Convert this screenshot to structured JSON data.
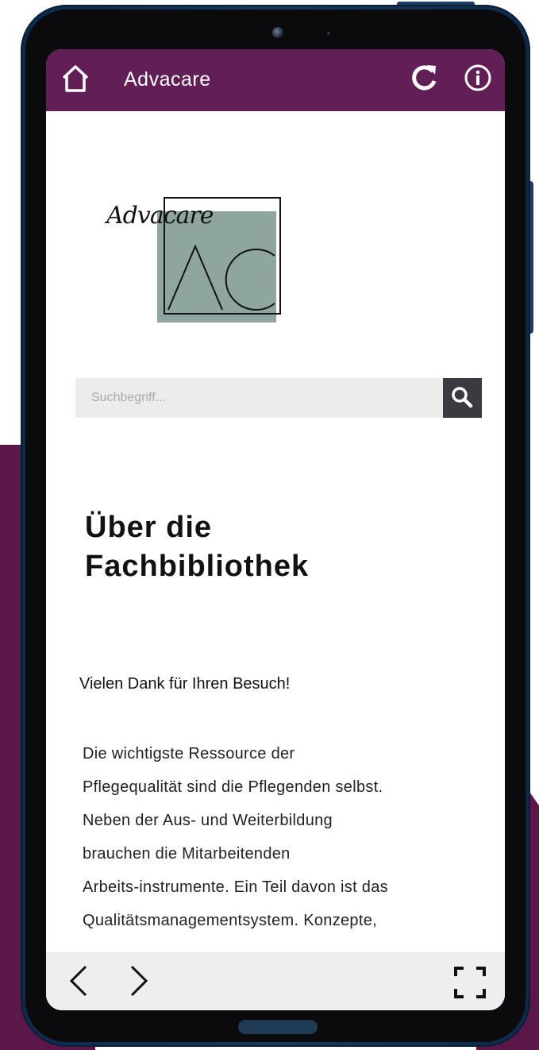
{
  "app": {
    "title": "Advacare"
  },
  "logo": {
    "script_text": "Advacare",
    "monogram": "AC"
  },
  "search": {
    "placeholder": "Suchbegriff..."
  },
  "content": {
    "heading_line1": "Über die",
    "heading_line2": "Fachbibliothek",
    "thanks": "Vielen Dank für Ihren Besuch!",
    "body_lines": [
      "Die wichtigste Ressource der",
      "Pflegequalität sind die Pflegenden selbst.",
      "Neben der Aus- und Weiterbildung",
      "brauchen die Mitarbeitenden",
      "Arbeits-instrumente. Ein Teil davon ist das",
      "Qualitätsmanagementsystem. Konzepte,"
    ]
  },
  "icons": {
    "home": "home-icon",
    "refresh": "refresh-icon",
    "info": "info-icon",
    "search": "search-icon",
    "prev": "chevron-left-icon",
    "next": "chevron-right-icon",
    "fullscreen": "fullscreen-icon"
  },
  "colors": {
    "appbar": "#621f55",
    "background_accent": "#5a1748",
    "phone_frame": "#163a5e",
    "search_button": "#3a3b40",
    "logo_fill": "#8fa6a0"
  }
}
